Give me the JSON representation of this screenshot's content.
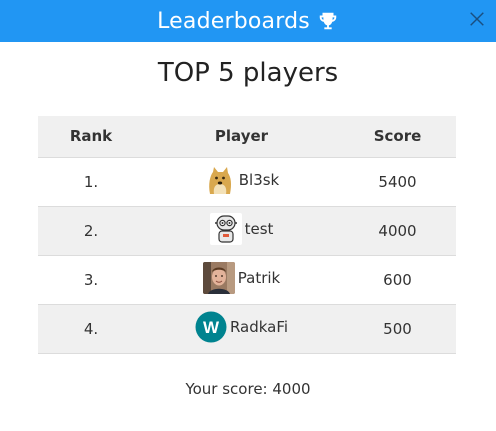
{
  "header": {
    "title": "Leaderboards",
    "icon": "trophy-icon",
    "close_icon": "close-icon"
  },
  "main": {
    "title": "TOP 5 players",
    "table": {
      "headers": {
        "rank": "Rank",
        "player": "Player",
        "score": "Score"
      },
      "rows": [
        {
          "rank": "1.",
          "player": "Bl3sk",
          "score": "5400",
          "avatar": "doge-avatar"
        },
        {
          "rank": "2.",
          "player": "test",
          "score": "4000",
          "avatar": "robot-avatar"
        },
        {
          "rank": "3.",
          "player": "Patrik",
          "score": "600",
          "avatar": "photo-avatar"
        },
        {
          "rank": "4.",
          "player": "RadkaFi",
          "score": "500",
          "avatar": "letter-w-avatar",
          "avatar_letter": "W"
        }
      ]
    },
    "your_score": "Your score: 4000"
  },
  "colors": {
    "header_bg": "#2196f3",
    "row_alt_bg": "#f0f0f0",
    "avatar_w_bg": "#00838f"
  }
}
